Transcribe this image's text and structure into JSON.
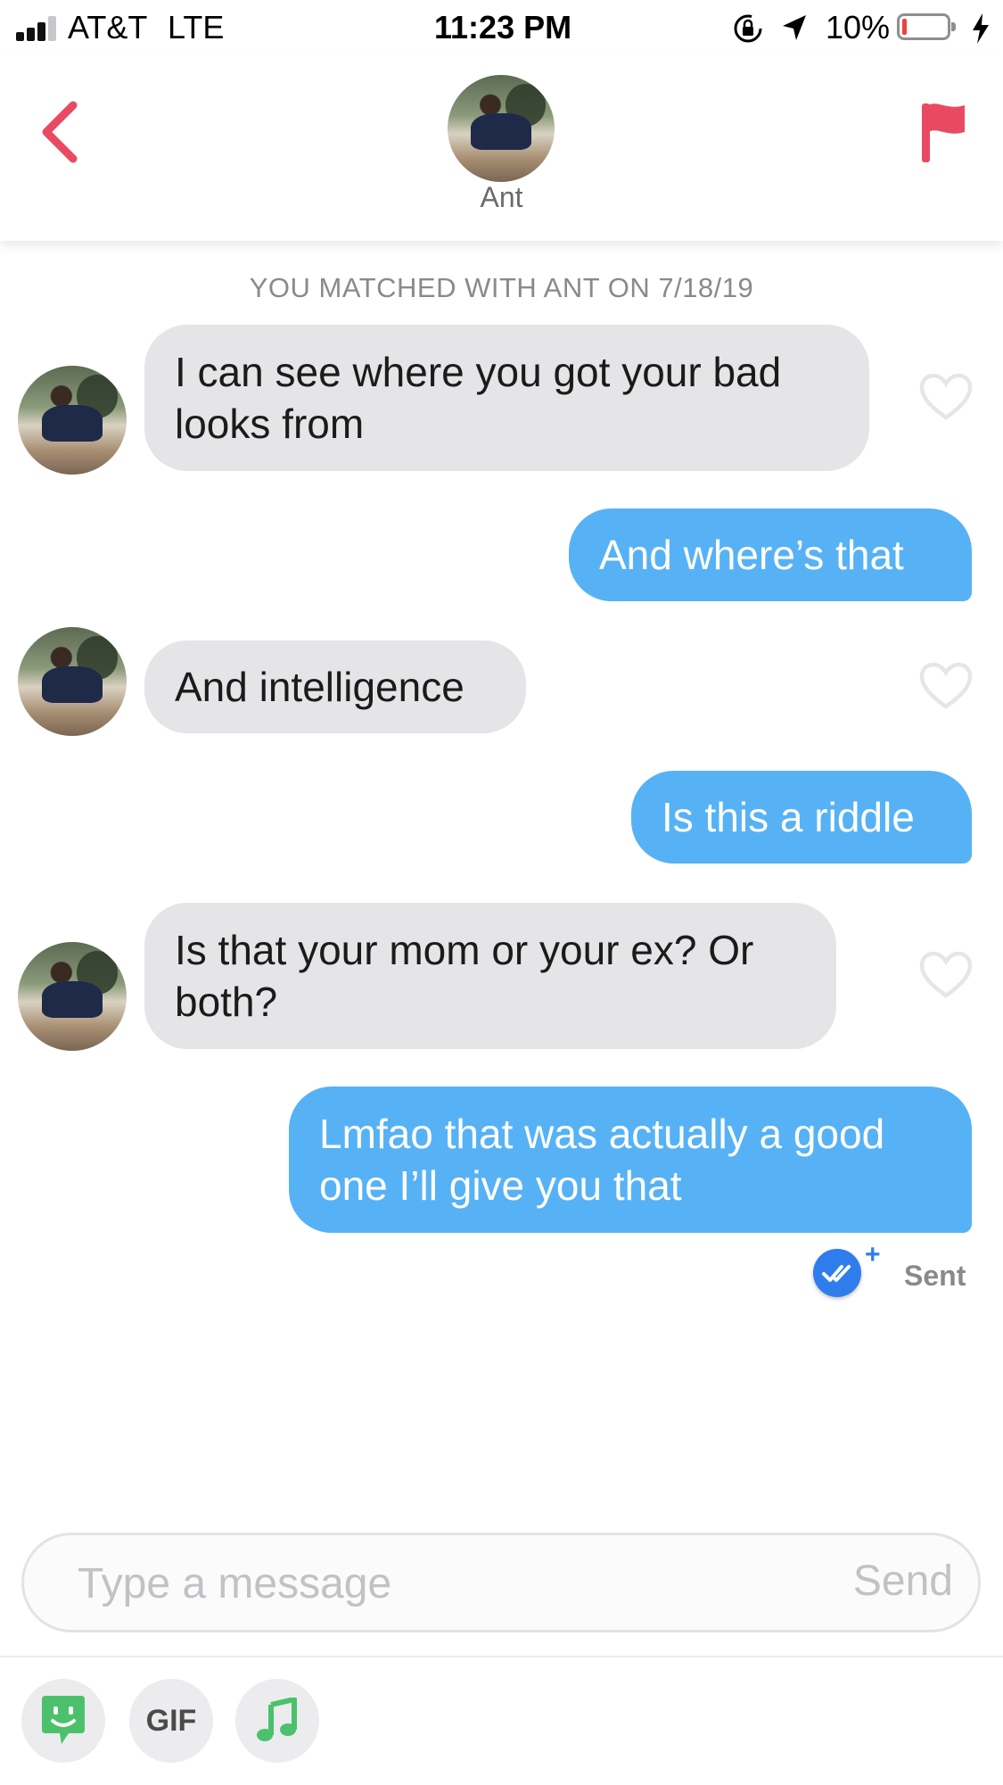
{
  "status_bar": {
    "carrier": "AT&T",
    "network": "LTE",
    "time": "11:23 PM",
    "battery": "10%",
    "battery_level": 0.1,
    "icons": [
      "signal-icon",
      "orientation-lock-icon",
      "location-arrow-icon",
      "battery-icon",
      "charging-bolt-icon"
    ]
  },
  "header": {
    "match_name": "Ant",
    "back_icon": "chevron-left-icon",
    "report_icon": "flag-icon",
    "accent_color": "#e94a62"
  },
  "conversation": {
    "match_note": "YOU MATCHED WITH ANT ON 7/18/19",
    "messages": [
      {
        "from": "them",
        "text_lines": [
          "I can see where you got your bad",
          "looks from"
        ]
      },
      {
        "from": "me",
        "text_lines": [
          "And where’s that"
        ]
      },
      {
        "from": "them",
        "text_lines": [
          "And intelligence"
        ]
      },
      {
        "from": "me",
        "text_lines": [
          "Is this a riddle"
        ]
      },
      {
        "from": "them",
        "text_lines": [
          "Is that your mom or your ex? Or",
          "both?"
        ]
      },
      {
        "from": "me",
        "text_lines": [
          "Lmfao that was actually a good",
          "one I’ll give you that"
        ]
      }
    ],
    "receipt": {
      "status": "Sent",
      "badge_color": "#2f7ded"
    },
    "colors": {
      "incoming_bubble": "#e5e5e8",
      "outgoing_bubble": "#56b2f5"
    }
  },
  "composer": {
    "placeholder": "Type a message",
    "value": "",
    "send_label": "Send"
  },
  "toolbar": {
    "gif_label": "GIF",
    "buttons": [
      "sticker-icon",
      "gif-button",
      "music-note-icon"
    ]
  }
}
